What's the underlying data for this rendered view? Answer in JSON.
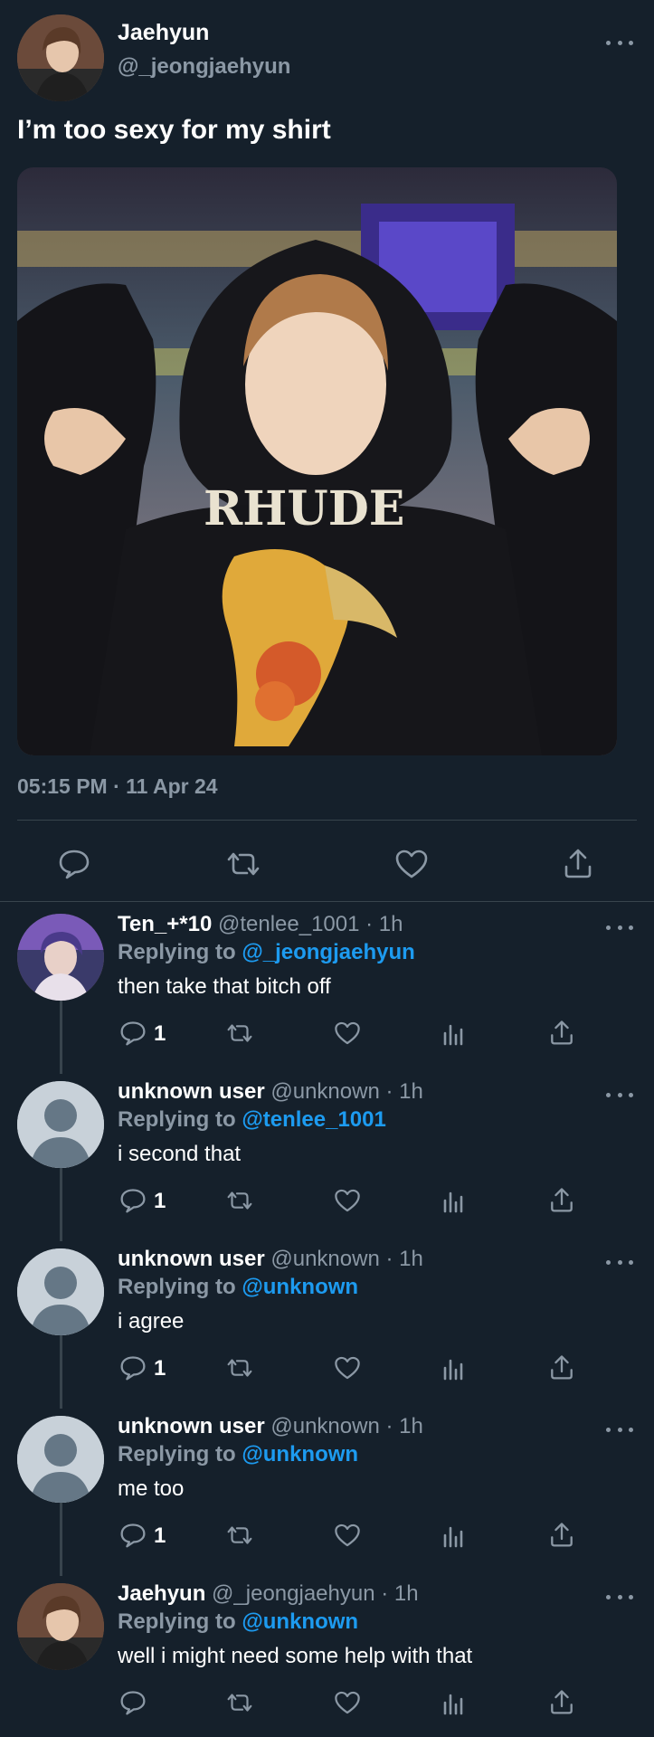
{
  "main_tweet": {
    "author_name": "Jaehyun",
    "author_handle": "@_jeongjaehyun",
    "text": "I’m too sexy for my shirt",
    "photo_shirt_text": "RHUDE",
    "timestamp": "05:15 PM · 11 Apr 24",
    "icons": [
      "reply-icon",
      "retweet-icon",
      "like-icon",
      "share-icon"
    ]
  },
  "replies": [
    {
      "name": "Ten_+*10",
      "handle_time": "@tenlee_1001 · 1h",
      "replying_label": "Replying to",
      "mention": "@_jeongjaehyun",
      "text": "then take that bitch off",
      "reply_count": "1",
      "avatar": "photo"
    },
    {
      "name": "unknown user",
      "handle_time": "@unknown · 1h",
      "replying_label": "Replying to",
      "mention": "@tenlee_1001",
      "text": "i second that",
      "reply_count": "1",
      "avatar": "default"
    },
    {
      "name": "unknown user",
      "handle_time": "@unknown · 1h",
      "replying_label": "Replying to",
      "mention": "@unknown",
      "text": "i agree",
      "reply_count": "1",
      "avatar": "default"
    },
    {
      "name": "unknown user",
      "handle_time": "@unknown · 1h",
      "replying_label": "Replying to",
      "mention": "@unknown",
      "text": "me too",
      "reply_count": "1",
      "avatar": "default"
    },
    {
      "name": "Jaehyun",
      "handle_time": "@_jeongjaehyun · 1h",
      "replying_label": "Replying to",
      "mention": "@unknown",
      "text": "well i might need some help with that",
      "reply_count": "",
      "avatar": "photo"
    }
  ],
  "colors": {
    "background": "#15202b",
    "secondary_text": "#8b98a5",
    "link": "#1d9bf0",
    "divider": "#38444d"
  }
}
